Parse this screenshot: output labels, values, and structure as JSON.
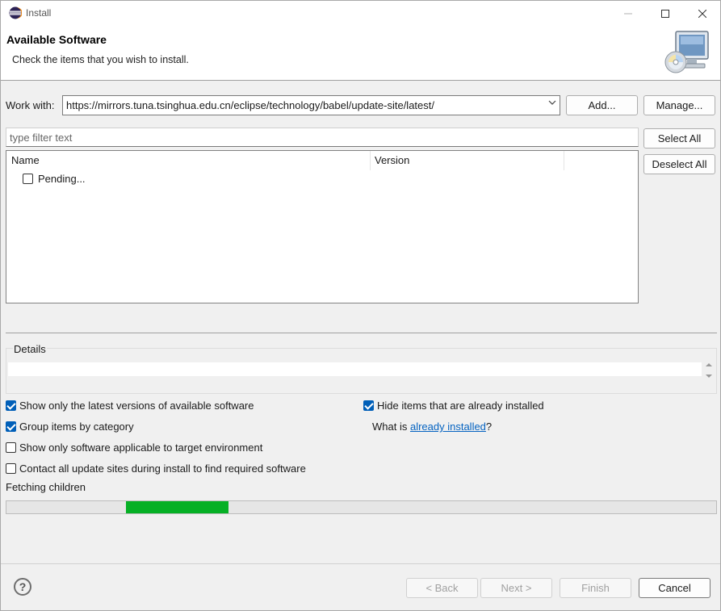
{
  "window": {
    "title": "Install"
  },
  "banner": {
    "title": "Available Software",
    "description": "Check the items that you wish to install."
  },
  "workwith": {
    "label": "Work with:",
    "value": "https://mirrors.tuna.tsinghua.edu.cn/eclipse/technology/babel/update-site/latest/",
    "add_label": "Add...",
    "manage_label": "Manage..."
  },
  "filter": {
    "placeholder": "type filter text"
  },
  "selection": {
    "select_all": "Select All",
    "deselect_all": "Deselect All"
  },
  "tree": {
    "columns": [
      "Name",
      "Version"
    ],
    "items": [
      {
        "label": "Pending...",
        "checked": false
      }
    ]
  },
  "details": {
    "label": "Details"
  },
  "options": {
    "latest_versions": {
      "label": "Show only the latest versions of available software",
      "checked": true
    },
    "group_by_category": {
      "label": "Group items by category",
      "checked": true
    },
    "target_env": {
      "label": "Show only software applicable to target environment",
      "checked": false
    },
    "contact_sites": {
      "label": "Contact all update sites during install to find required software",
      "checked": false
    },
    "hide_installed": {
      "label": "Hide items that are already installed",
      "checked": true
    },
    "what_is_prefix": "What is ",
    "what_is_link": "already installed",
    "what_is_suffix": "?"
  },
  "status": {
    "text": "Fetching children",
    "progress_start": 0.168,
    "progress_fraction": 0.144
  },
  "footer": {
    "back_label": "< Back",
    "next_label": "Next >",
    "finish_label": "Finish",
    "cancel_label": "Cancel",
    "help_glyph": "?"
  },
  "colors": {
    "accent": "#005fb8",
    "progress": "#06b025",
    "link": "#0563c1"
  }
}
